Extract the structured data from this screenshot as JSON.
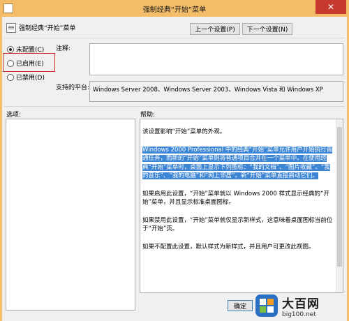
{
  "window": {
    "title": "强制经典“开始”菜单",
    "close_glyph": "✕"
  },
  "header": {
    "title": "强制经典“开始”菜单",
    "prev_button": "上一个设置(P)",
    "next_button": "下一个设置(N)"
  },
  "state": {
    "options": [
      {
        "label": "未配置(C)",
        "selected": true
      },
      {
        "label": "已启用(E)",
        "selected": false
      },
      {
        "label": "已禁用(D)",
        "selected": false
      }
    ]
  },
  "comment": {
    "label": "注释:",
    "value": ""
  },
  "platform": {
    "label": "支持的平台:",
    "value": "Windows Server 2008、Windows Server 2003、Windows Vista 和 Windows XP"
  },
  "options_panel": {
    "label": "选项:"
  },
  "help_panel": {
    "label": "帮助:",
    "paragraphs": [
      "该设置影响“开始”菜单的外观。",
      "Windows 2000 Professional 中的经典“开始”菜单允许用户开始执行普通任务，而新的“开始”菜单则将普通项目合并在一个菜单中。在使用经典“开始”菜单时，桌面上显示下列图标：“我的文档”、“图片收藏”、“我的音乐”、“我的电脑”和“网上邻居”。新“开始”菜单直接启动它们。",
      "如果启用此设置，“开始”菜单就以 Windows 2000 样式显示经典的“开始”菜单，并且显示标准桌面图标。",
      "如果禁用此设置，“开始”菜单就仅显示新样式，这意味着桌面图标当前位于“开始”页。",
      "如果不配置此设置，默认样式为新样式，并且用户可更改此视图。"
    ]
  },
  "footer": {
    "ok_button": "确定"
  },
  "watermark": {
    "title": "大百网",
    "url": "big100.net"
  },
  "colors": {
    "titlebar": "#f3bd6a",
    "selection": "#3d86d6",
    "highlight_box": "#d12a2a",
    "close": "#c7392e"
  }
}
